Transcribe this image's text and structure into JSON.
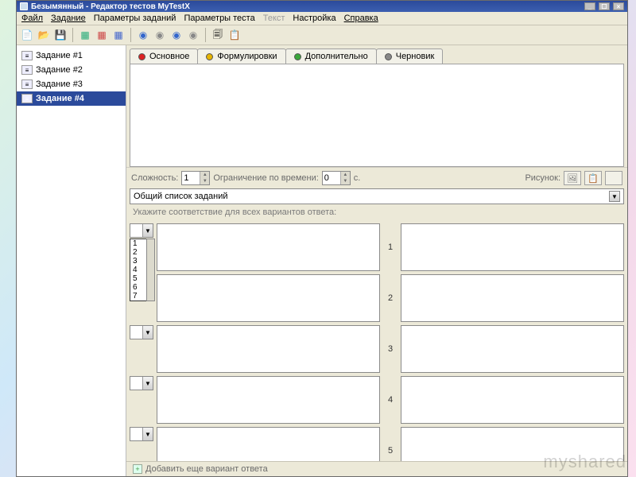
{
  "title": "Безымянный - Редактор тестов MyTestX",
  "menu": {
    "file": "Файл",
    "task": "Задание",
    "taskParams": "Параметры заданий",
    "testParams": "Параметры теста",
    "text": "Текст",
    "settings": "Настройка",
    "help": "Справка"
  },
  "sidebar": [
    {
      "label": "Задание #1",
      "selected": false
    },
    {
      "label": "Задание #2",
      "selected": false
    },
    {
      "label": "Задание #3",
      "selected": false
    },
    {
      "label": "Задание #4",
      "selected": true
    }
  ],
  "tabs": [
    {
      "label": "Основное",
      "dot": "#d22"
    },
    {
      "label": "Формулировки",
      "dot": "#e6b400"
    },
    {
      "label": "Дополнительно",
      "dot": "#3aa63a"
    },
    {
      "label": "Черновик",
      "dot": "#888"
    }
  ],
  "params": {
    "complexityLabel": "Сложность:",
    "complexityValue": "1",
    "timeLimitLabel": "Ограничение по времени:",
    "timeLimitValue": "0",
    "timeLimitUnit": "с.",
    "pictureLabel": "Рисунок:"
  },
  "listTitle": "Общий список заданий",
  "instruction": "Укажите соответствие для всех вариантов ответа:",
  "listboxOptions": [
    "1",
    "2",
    "3",
    "4",
    "5",
    "6",
    "7"
  ],
  "rows": [
    {
      "num": "1",
      "showList": true
    },
    {
      "num": "2",
      "showList": false
    },
    {
      "num": "3",
      "showList": false
    },
    {
      "num": "4",
      "showList": false
    },
    {
      "num": "5",
      "showList": false
    }
  ],
  "addLabel": "Добавить еще вариант ответа",
  "watermark": "myshared"
}
